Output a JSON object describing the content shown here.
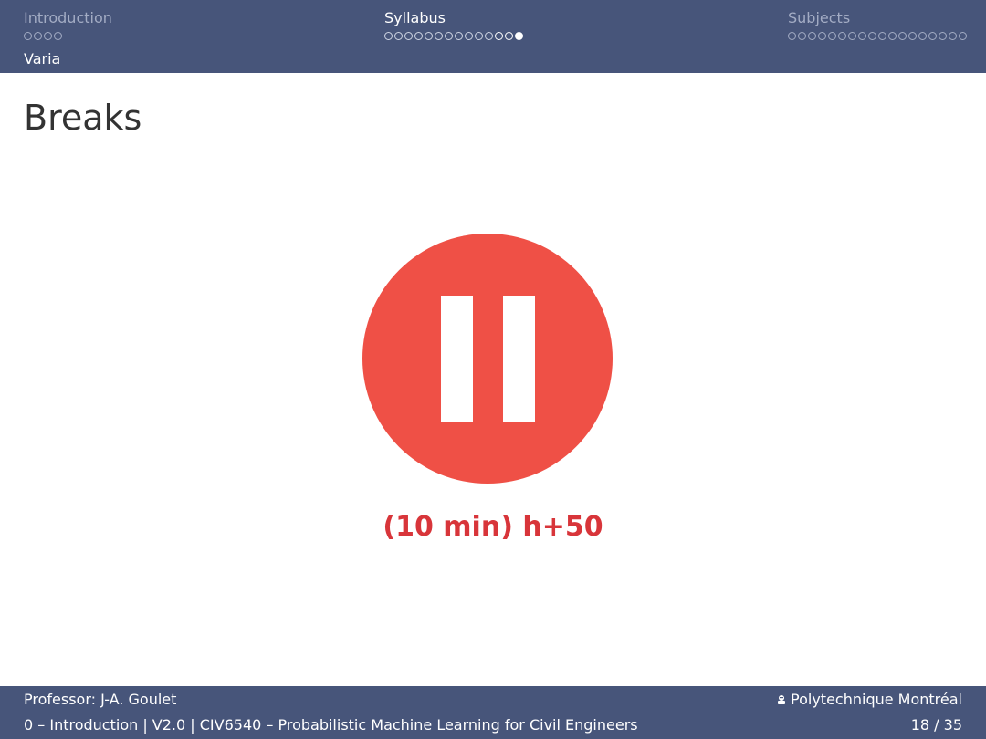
{
  "nav": {
    "sections": [
      {
        "title": "Introduction",
        "dots": 4,
        "visited": 0,
        "current": -1,
        "active": false
      },
      {
        "title": "Syllabus",
        "dots": 14,
        "visited": 2,
        "current": 13,
        "active": true
      },
      {
        "title": "Subjects",
        "dots": 18,
        "visited": 0,
        "current": -1,
        "active": false
      }
    ],
    "subsection": "Varia"
  },
  "slide": {
    "title": "Breaks",
    "icon": "pause-icon",
    "break_text": "(10 min) h+50"
  },
  "footer": {
    "professor": "Professor: J-A. Goulet",
    "institution": "Polytechnique Montréal",
    "course": "0 – Introduction | V2.0 | CIV6540 – Probabilistic Machine Learning for Civil Engineers",
    "page": "18 / 35"
  },
  "colors": {
    "bar": "#47557a",
    "pause_circle": "#ef5046",
    "break_text": "#d8353a"
  }
}
